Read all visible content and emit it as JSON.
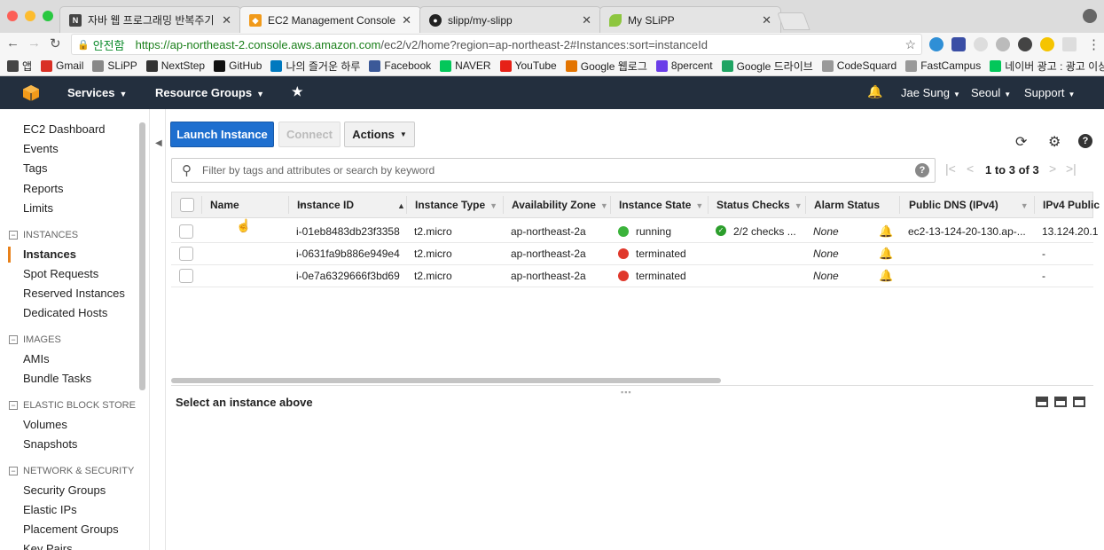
{
  "browser": {
    "tabs": [
      {
        "label": "자바 웹 프로그래밍 반복주기",
        "icon": "naver-n-icon"
      },
      {
        "label": "EC2 Management Console",
        "icon": "aws-cube-icon"
      },
      {
        "label": "slipp/my-slipp",
        "icon": "github-icon"
      },
      {
        "label": "My SLiPP",
        "icon": "leaf-icon"
      }
    ],
    "secure_label": "안전함",
    "url_main": "https://ap-northeast-2.console.aws.amazon.com",
    "url_rest": "/ec2/v2/home?region=ap-northeast-2#Instances:sort=instanceId",
    "bookmarks": [
      {
        "label": "앱",
        "icon": "apps-grid-icon",
        "color": "#444444"
      },
      {
        "label": "Gmail",
        "icon": "gmail-icon",
        "color": "#d93025"
      },
      {
        "label": "SLiPP",
        "icon": "slipp-icon",
        "color": "#888888"
      },
      {
        "label": "NextStep",
        "icon": "nextstep-icon",
        "color": "#333333"
      },
      {
        "label": "GitHub",
        "icon": "github-icon",
        "color": "#111111"
      },
      {
        "label": "나의 즐거운 하루",
        "icon": "trello-icon",
        "color": "#0079bf"
      },
      {
        "label": "Facebook",
        "icon": "facebook-icon",
        "color": "#3b5998"
      },
      {
        "label": "NAVER",
        "icon": "naver-icon",
        "color": "#03c75a"
      },
      {
        "label": "YouTube",
        "icon": "youtube-icon",
        "color": "#e62117"
      },
      {
        "label": "Google 웹로그",
        "icon": "analytics-icon",
        "color": "#e37400"
      },
      {
        "label": "8percent",
        "icon": "8percent-icon",
        "color": "#6a3de8"
      },
      {
        "label": "Google 드라이브",
        "icon": "drive-icon",
        "color": "#1fa463"
      },
      {
        "label": "CodeSquard",
        "icon": "folder-icon",
        "color": "#999999"
      },
      {
        "label": "FastCampus",
        "icon": "folder-icon",
        "color": "#999999"
      },
      {
        "label": "네이버 광고 : 광고 이상...",
        "icon": "naver-icon",
        "color": "#03c75a"
      }
    ]
  },
  "aws": {
    "services_label": "Services",
    "resource_groups_label": "Resource Groups",
    "user_label": "Jae Sung",
    "region_label": "Seoul",
    "support_label": "Support"
  },
  "sidebar": {
    "top_items": [
      "EC2 Dashboard",
      "Events",
      "Tags",
      "Reports",
      "Limits"
    ],
    "instances_section": "INSTANCES",
    "instances_items": [
      "Instances",
      "Spot Requests",
      "Reserved Instances",
      "Dedicated Hosts"
    ],
    "images_section": "IMAGES",
    "images_items": [
      "AMIs",
      "Bundle Tasks"
    ],
    "ebs_section": "ELASTIC BLOCK STORE",
    "ebs_items": [
      "Volumes",
      "Snapshots"
    ],
    "network_section": "NETWORK & SECURITY",
    "network_items": [
      "Security Groups",
      "Elastic IPs",
      "Placement Groups",
      "Key Pairs"
    ]
  },
  "toolbar": {
    "launch_label": "Launch Instance",
    "connect_label": "Connect",
    "actions_label": "Actions"
  },
  "search": {
    "placeholder": "Filter by tags and attributes or search by keyword"
  },
  "pager": {
    "text": "1 to 3 of 3"
  },
  "table": {
    "columns": [
      "Name",
      "Instance ID",
      "Instance Type",
      "Availability Zone",
      "Instance State",
      "Status Checks",
      "Alarm Status",
      "Public DNS (IPv4)",
      "IPv4 Public"
    ],
    "rows": [
      {
        "name": "",
        "instance_id": "i-01eb8483db23f3358",
        "type": "t2.micro",
        "zone": "ap-northeast-2a",
        "state": "running",
        "state_color": "#3bb33b",
        "status": "2/2 checks ...",
        "alarm": "None",
        "dns": "ec2-13-124-20-130.ap-...",
        "ip": "13.124.20.1"
      },
      {
        "name": "",
        "instance_id": "i-0631fa9b886e949e4",
        "type": "t2.micro",
        "zone": "ap-northeast-2a",
        "state": "terminated",
        "state_color": "#e0382b",
        "status": "",
        "alarm": "None",
        "dns": "",
        "ip": "-"
      },
      {
        "name": "",
        "instance_id": "i-0e7a6329666f3bd69",
        "type": "t2.micro",
        "zone": "ap-northeast-2a",
        "state": "terminated",
        "state_color": "#e0382b",
        "status": "",
        "alarm": "None",
        "dns": "",
        "ip": "-"
      }
    ]
  },
  "detail": {
    "message": "Select an instance above"
  }
}
